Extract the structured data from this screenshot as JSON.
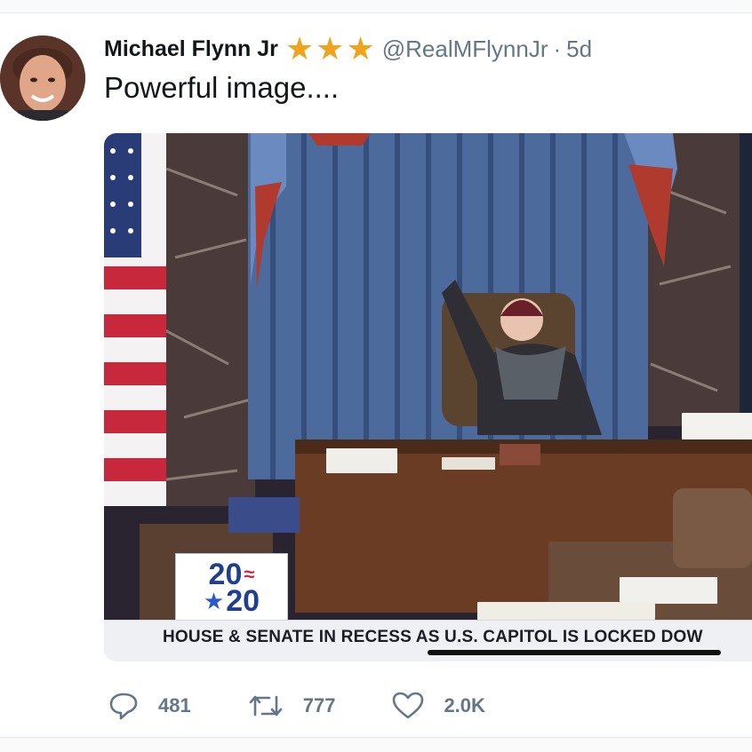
{
  "tweet": {
    "author_name": "Michael Flynn Jr",
    "handle": "@RealMFlynnJr",
    "separator": "·",
    "age": "5d",
    "stars": [
      "star-icon",
      "star-icon",
      "star-icon"
    ],
    "text": "Powerful image....",
    "avatar_icon": "profile-photo"
  },
  "media": {
    "logo_line1": "20",
    "logo_line2": "20",
    "ticker_text": "HOUSE & SENATE IN RECESS AS U.S. CAPITOL IS LOCKED DOW"
  },
  "actions": {
    "replies": "481",
    "retweets": "777",
    "likes": "2.0K"
  },
  "colors": {
    "star": "#f0a41e",
    "muted": "#657786",
    "curtain": "#4d6a9c"
  }
}
